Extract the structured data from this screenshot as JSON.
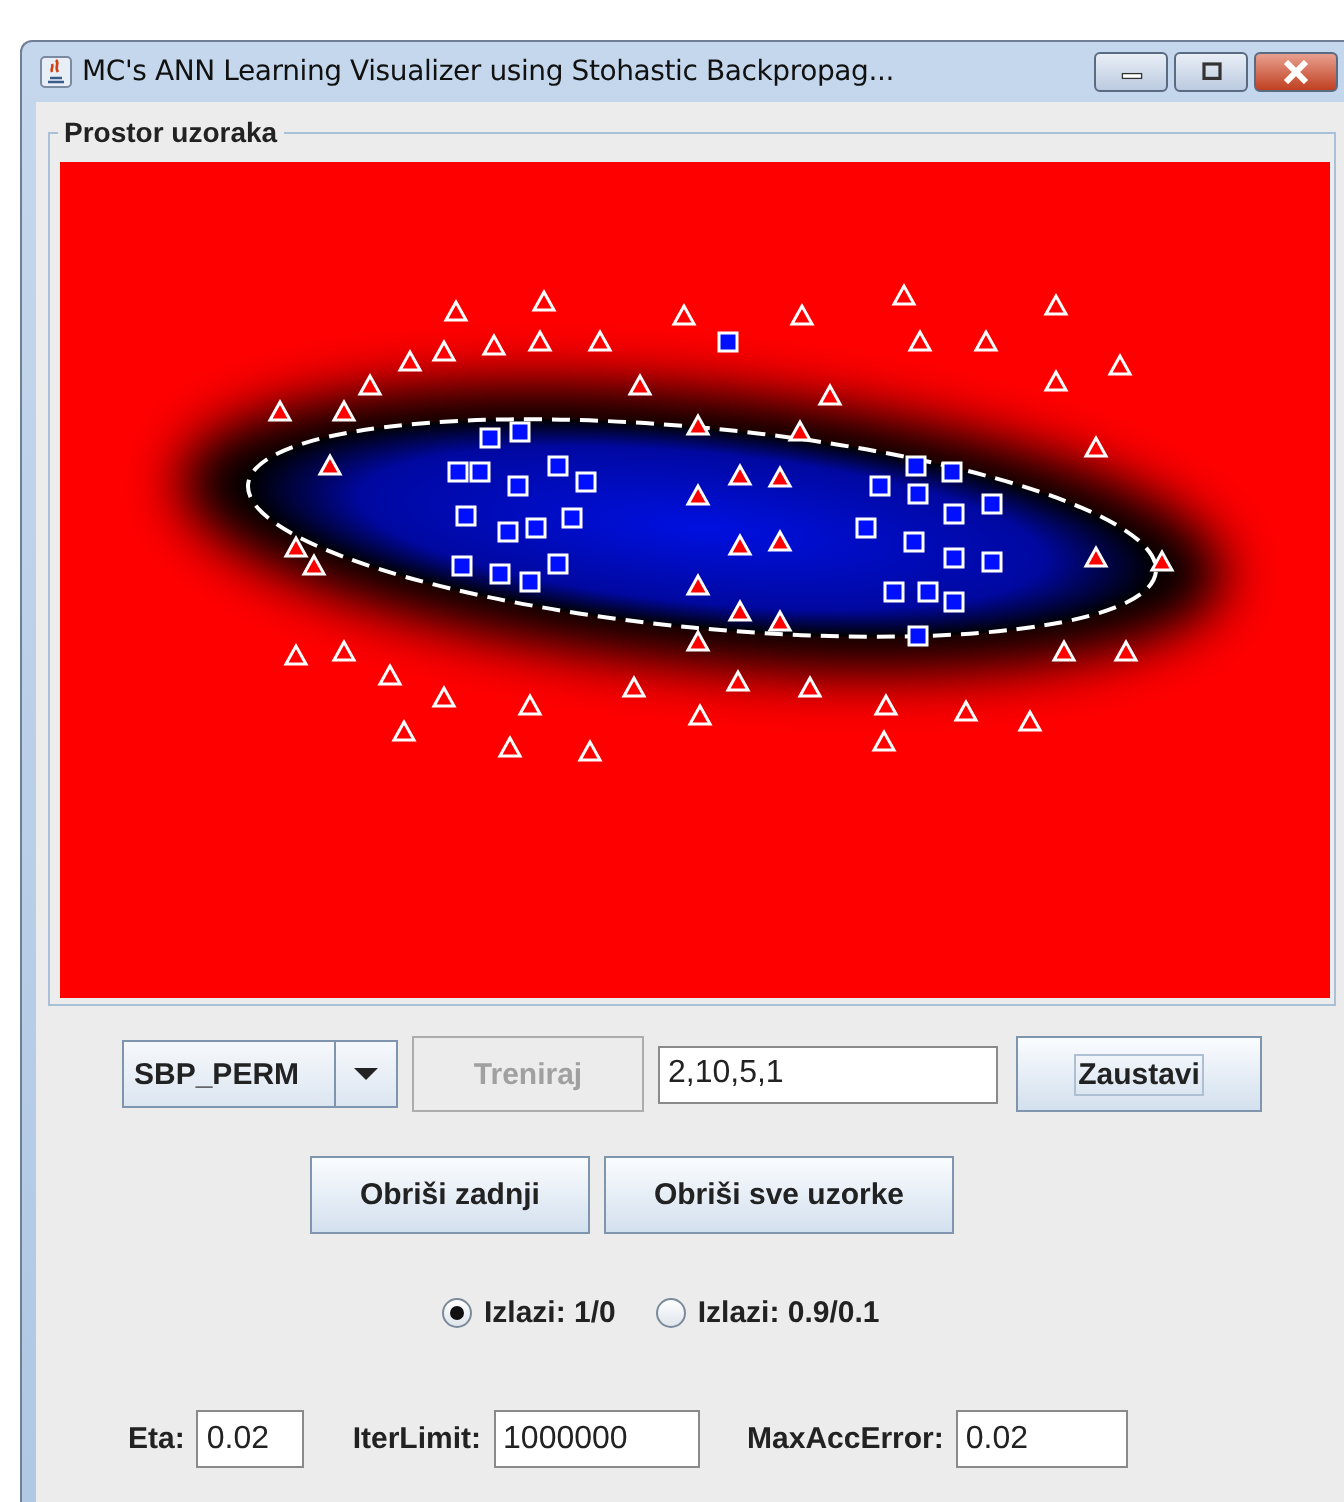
{
  "window": {
    "title": "MC's ANN Learning Visualizer using Stohastic Backpropag..."
  },
  "panel": {
    "title": "Prostor uzoraka"
  },
  "algorithm_combo": {
    "value": "SBP_PERM"
  },
  "train_button": {
    "label": "Treniraj",
    "disabled": true
  },
  "layers_field": {
    "value": "2,10,5,1"
  },
  "stop_button": {
    "label": "Zaustavi",
    "disabled": false
  },
  "action_buttons": [
    {
      "label": "Obriši zadnji"
    },
    {
      "label": "Obriši sve uzorke"
    }
  ],
  "output_options": [
    {
      "label": "Izlazi: 1/0",
      "selected": true
    },
    {
      "label": "Izlazi: 0.9/0.1",
      "selected": false
    }
  ],
  "parameters": [
    {
      "label": "Eta:",
      "value": "0.02"
    },
    {
      "label": "IterLimit:",
      "value": "1000000"
    },
    {
      "label": "MaxAccError:",
      "value": "0.02"
    }
  ]
}
